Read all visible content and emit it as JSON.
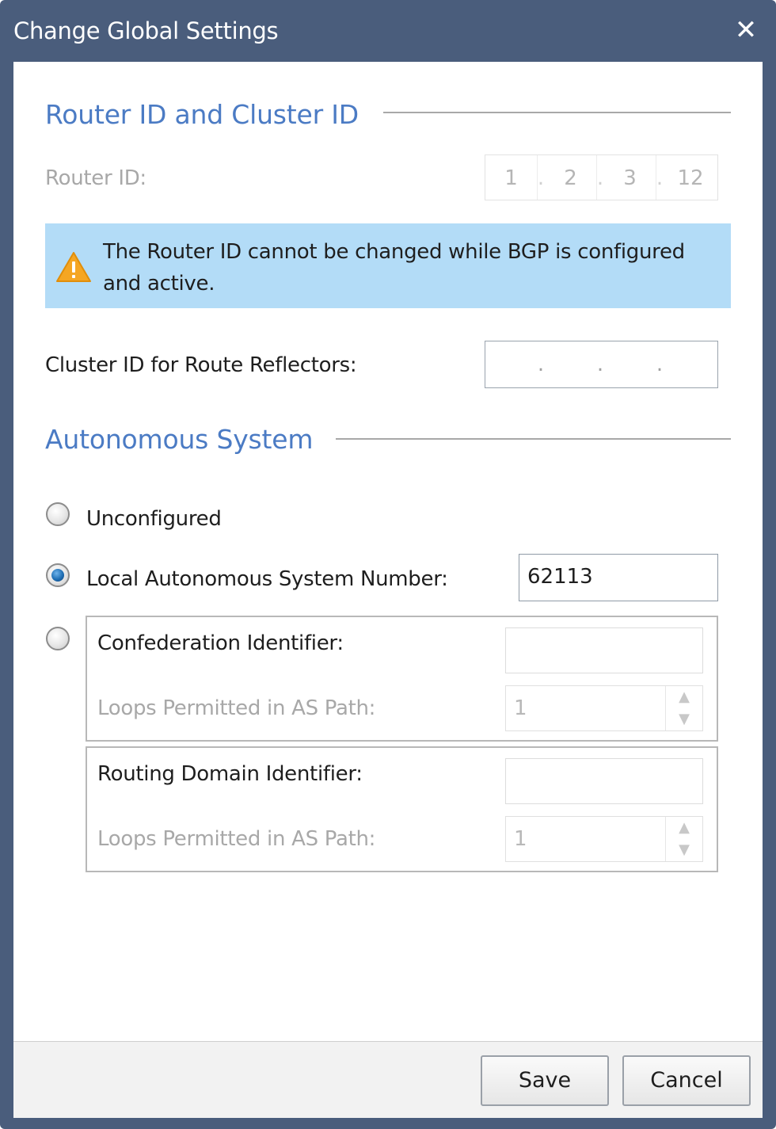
{
  "window": {
    "title": "Change Global Settings",
    "close_glyph": "✕"
  },
  "router_section": {
    "title": "Router ID and Cluster ID",
    "router_id_label": "Router ID:",
    "router_id_octets": [
      "1",
      "2",
      "3",
      "12"
    ],
    "separator": ".",
    "warning_text": "The Router ID cannot be changed while BGP is configured and active.",
    "warning_icon": "warning-triangle-icon",
    "cluster_label": "Cluster ID for Route Reflectors:",
    "cluster_octets": [
      "",
      "",
      "",
      ""
    ]
  },
  "as_section": {
    "title": "Autonomous System",
    "unconfigured_label": "Unconfigured",
    "local_as_label": "Local Autonomous System Number:",
    "local_as_value": "62113",
    "selected_option": "local_as",
    "confederation": {
      "identifier_label": "Confederation Identifier:",
      "identifier_value": "",
      "loops_label": "Loops Permitted in AS Path:",
      "loops_value": "1"
    },
    "routing_domain": {
      "identifier_label": "Routing Domain Identifier:",
      "identifier_value": "",
      "loops_label": "Loops Permitted in AS Path:",
      "loops_value": "1"
    }
  },
  "footer": {
    "save_label": "Save",
    "cancel_label": "Cancel"
  },
  "colors": {
    "titlebar": "#4a5d7c",
    "section_title": "#4b7bc4",
    "warning_bg": "#b3dcf7",
    "warning_icon": "#f5a623"
  }
}
